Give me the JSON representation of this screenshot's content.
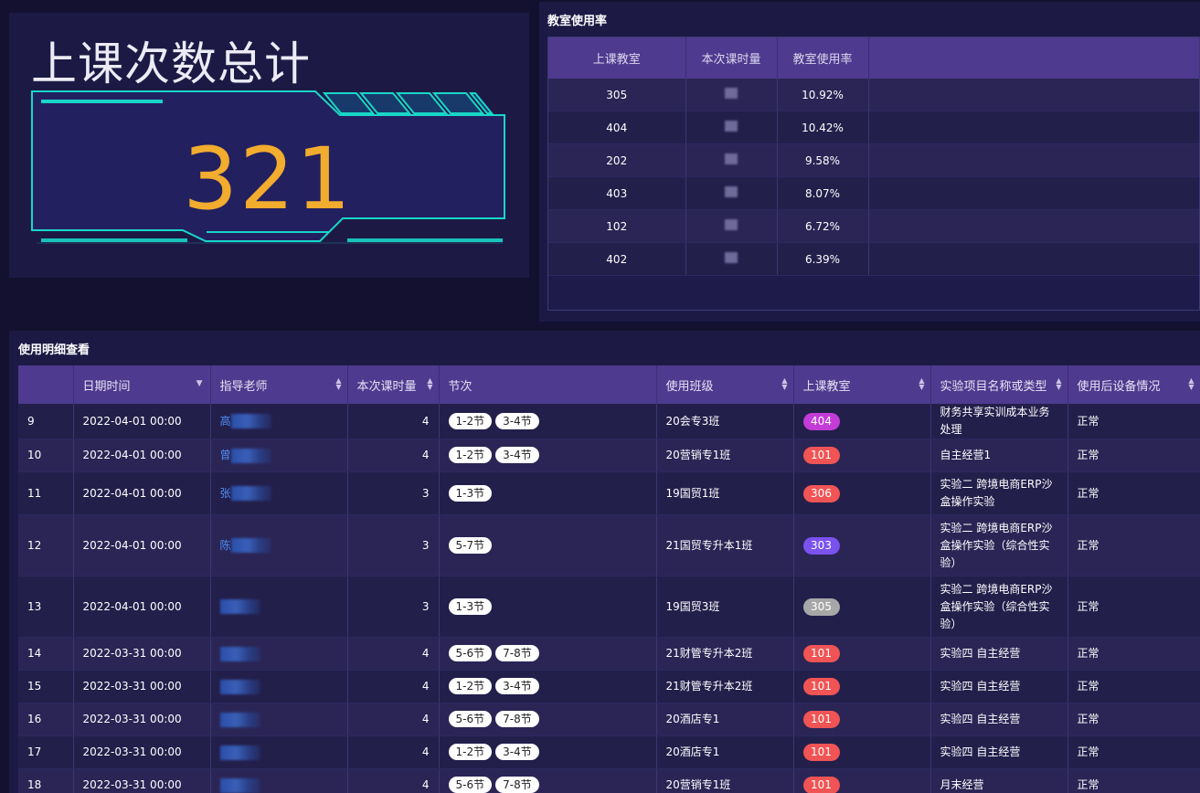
{
  "total_panel": {
    "title": "上课次数总计",
    "value": "321"
  },
  "rate_panel": {
    "title": "教室使用率",
    "headers": [
      "上课教室",
      "本次课时量",
      "教室使用率"
    ],
    "rows": [
      {
        "room": "305",
        "rate": "10.92%"
      },
      {
        "room": "404",
        "rate": "10.42%"
      },
      {
        "room": "202",
        "rate": "9.58%"
      },
      {
        "room": "403",
        "rate": "8.07%"
      },
      {
        "room": "102",
        "rate": "6.72%"
      },
      {
        "room": "402",
        "rate": "6.39%"
      }
    ]
  },
  "detail_panel": {
    "title": "使用明细查看",
    "headers": [
      "",
      "日期时间",
      "指导老师",
      "本次课时量",
      "节次",
      "使用班级",
      "上课教室",
      "实验项目名称或类型",
      "使用后设备情况"
    ],
    "rows": [
      {
        "no": "9",
        "date": "2022-04-01 00:00",
        "teacher": "高",
        "hours": "4",
        "slots": [
          "1-2节",
          "3-4节"
        ],
        "class": "20会专3班",
        "room": "404",
        "room_color": "#c33cd8",
        "project": "财务共享实训成本业务处理",
        "status": "正常"
      },
      {
        "no": "10",
        "date": "2022-04-01 00:00",
        "teacher": "曾",
        "hours": "4",
        "slots": [
          "1-2节",
          "3-4节"
        ],
        "class": "20营销专1班",
        "room": "101",
        "room_color": "#f05454",
        "project": "自主经营1",
        "status": "正常"
      },
      {
        "no": "11",
        "date": "2022-04-01 00:00",
        "teacher": "张",
        "hours": "3",
        "slots": [
          "1-3节"
        ],
        "class": "19国贸1班",
        "room": "306",
        "room_color": "#f05454",
        "project": "实验二 跨境电商ERP沙盒操作实验",
        "status": "正常"
      },
      {
        "no": "12",
        "date": "2022-04-01 00:00",
        "teacher": "陈",
        "hours": "3",
        "slots": [
          "5-7节"
        ],
        "class": "21国贸专升本1班",
        "room": "303",
        "room_color": "#7a52ee",
        "project": "实验二 跨境电商ERP沙盒操作实验（综合性实验）",
        "status": "正常"
      },
      {
        "no": "13",
        "date": "2022-04-01 00:00",
        "teacher": "",
        "hours": "3",
        "slots": [
          "1-3节"
        ],
        "class": "19国贸3班",
        "room": "305",
        "room_color": "#a7a7a7",
        "project": "实验二 跨境电商ERP沙盒操作实验（综合性实验）",
        "status": "正常"
      },
      {
        "no": "14",
        "date": "2022-03-31 00:00",
        "teacher": "",
        "hours": "4",
        "slots": [
          "5-6节",
          "7-8节"
        ],
        "class": "21财管专升本2班",
        "room": "101",
        "room_color": "#f05454",
        "project": "实验四 自主经营",
        "status": "正常"
      },
      {
        "no": "15",
        "date": "2022-03-31 00:00",
        "teacher": "",
        "hours": "4",
        "slots": [
          "1-2节",
          "3-4节"
        ],
        "class": "21财管专升本2班",
        "room": "101",
        "room_color": "#f05454",
        "project": "实验四 自主经营",
        "status": "正常"
      },
      {
        "no": "16",
        "date": "2022-03-31 00:00",
        "teacher": "",
        "hours": "4",
        "slots": [
          "5-6节",
          "7-8节"
        ],
        "class": "20酒店专1",
        "room": "101",
        "room_color": "#f05454",
        "project": "实验四 自主经营",
        "status": "正常"
      },
      {
        "no": "17",
        "date": "2022-03-31 00:00",
        "teacher": "",
        "hours": "4",
        "slots": [
          "1-2节",
          "3-4节"
        ],
        "class": "20酒店专1",
        "room": "101",
        "room_color": "#f05454",
        "project": "实验四 自主经营",
        "status": "正常"
      },
      {
        "no": "18",
        "date": "2022-03-31 00:00",
        "teacher": "",
        "hours": "4",
        "slots": [
          "5-6节",
          "7-8节"
        ],
        "class": "20营销专1班",
        "room": "101",
        "room_color": "#f05454",
        "project": "月末经营",
        "status": "正常"
      }
    ]
  },
  "colors": {
    "accent_cyan": "#19d6c8",
    "number_orange": "#f2ac2e",
    "header_purple": "#4e3a8e"
  }
}
